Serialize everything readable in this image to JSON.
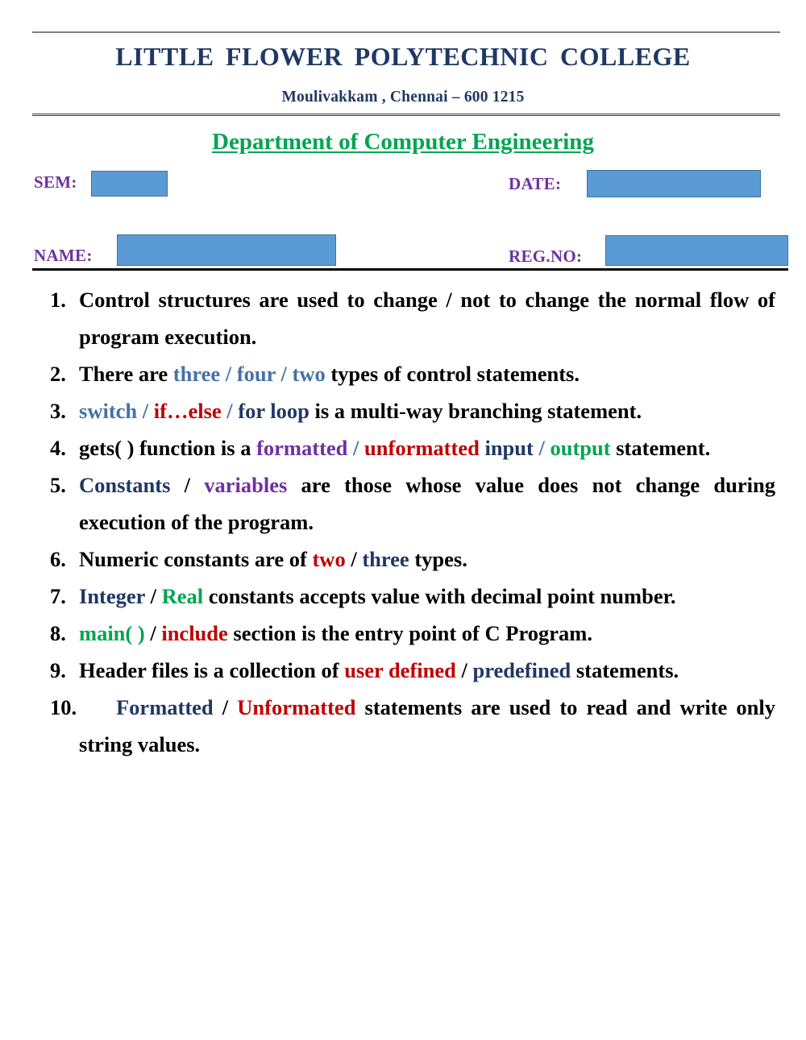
{
  "header": {
    "college_name": "LITTLE  FLOWER  POLYTECHNIC  COLLEGE",
    "address": "Moulivakkam , Chennai – 600 1215",
    "department": "Department of Computer Engineering",
    "colors": {
      "title_navy": "#1F3864",
      "department_green": "#00A550",
      "label_purple": "#7030A0",
      "field_fill_blue": "#5B9BD5",
      "field_border_blue": "#41719C"
    }
  },
  "form": {
    "sem_label": "SEM:",
    "sem_value": "",
    "date_label": "DATE:",
    "date_value": "",
    "name_label": "NAME:",
    "name_value": "",
    "regno_label": "REG.NO:",
    "regno_value": ""
  },
  "questions": [
    {
      "number": "1.",
      "parts": [
        {
          "text": "Control structures are used to change /  not to change the normal flow of program execution.",
          "color": "black"
        }
      ]
    },
    {
      "number": "2.",
      "parts": [
        {
          "text": "There are ",
          "color": "black"
        },
        {
          "text": "three",
          "color": "blue"
        },
        {
          "text": " / ",
          "color": "slash-blue"
        },
        {
          "text": "four",
          "color": "blue"
        },
        {
          "text": " / ",
          "color": "slash-blue"
        },
        {
          "text": "two",
          "color": "blue"
        },
        {
          "text": " types of control statements.",
          "color": "black"
        }
      ]
    },
    {
      "number": "3.",
      "parts": [
        {
          "text": "switch",
          "color": "blue"
        },
        {
          "text": " / ",
          "color": "slash-blue"
        },
        {
          "text": "if…else",
          "color": "red"
        },
        {
          "text": " / ",
          "color": "slash-blue"
        },
        {
          "text": "for loop",
          "color": "navy"
        },
        {
          "text": " is a multi-way branching statement.",
          "color": "black"
        }
      ]
    },
    {
      "number": "4.",
      "parts": [
        {
          "text": "gets( ) function is a ",
          "color": "black"
        },
        {
          "text": "formatted",
          "color": "purple"
        },
        {
          "text": " / ",
          "color": "slash-blue"
        },
        {
          "text": "unformatted",
          "color": "red"
        },
        {
          "text": " ",
          "color": "black"
        },
        {
          "text": "input",
          "color": "navy"
        },
        {
          "text": " / ",
          "color": "slash-blue"
        },
        {
          "text": "output",
          "color": "green"
        },
        {
          "text": " statement.",
          "color": "black"
        }
      ]
    },
    {
      "number": "5.",
      "parts": [
        {
          "text": "Constants",
          "color": "navy"
        },
        {
          "text": " / ",
          "color": "black"
        },
        {
          "text": "variables",
          "color": "purple"
        },
        {
          "text": " are those whose value does not change during execution of the program.",
          "color": "black"
        }
      ]
    },
    {
      "number": "6.",
      "parts": [
        {
          "text": "Numeric constants are of ",
          "color": "black"
        },
        {
          "text": "two",
          "color": "red"
        },
        {
          "text": " / ",
          "color": "black"
        },
        {
          "text": "three",
          "color": "navy"
        },
        {
          "text": " types.",
          "color": "black"
        }
      ]
    },
    {
      "number": "7.",
      "parts": [
        {
          "text": "Integer",
          "color": "navy"
        },
        {
          "text": " / ",
          "color": "black"
        },
        {
          "text": "Real",
          "color": "green"
        },
        {
          "text": " constants accepts value with decimal point number.",
          "color": "black"
        }
      ]
    },
    {
      "number": "8.",
      "parts": [
        {
          "text": "main( )",
          "color": "green"
        },
        {
          "text": " / ",
          "color": "black"
        },
        {
          "text": "include",
          "color": "red"
        },
        {
          "text": " section is the entry point of C Program.",
          "color": "black"
        }
      ]
    },
    {
      "number": "9.",
      "parts": [
        {
          "text": "Header files is a collection of ",
          "color": "black"
        },
        {
          "text": "user defined",
          "color": "red"
        },
        {
          "text": " / ",
          "color": "black"
        },
        {
          "text": "predefined",
          "color": "navy"
        },
        {
          "text": " statements.",
          "color": "black"
        }
      ]
    },
    {
      "number": "10.",
      "parts": [
        {
          "text": "Formatted",
          "color": "navy"
        },
        {
          "text": " / ",
          "color": "black"
        },
        {
          "text": "Unformatted",
          "color": "red"
        },
        {
          "text": " statements are used to read and write only string values.",
          "color": "black"
        }
      ]
    }
  ]
}
